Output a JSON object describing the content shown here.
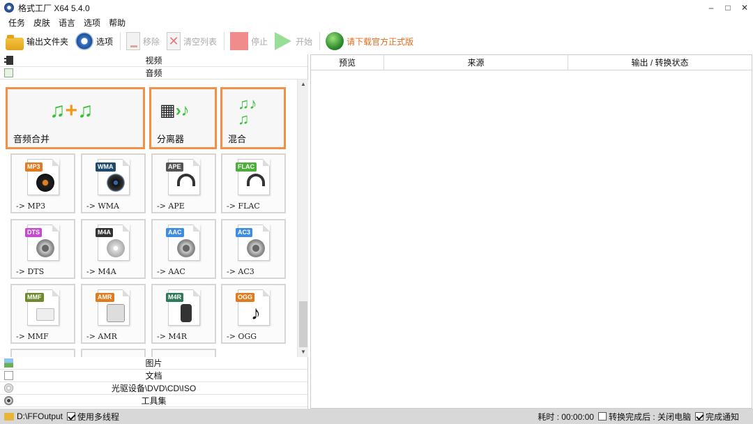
{
  "window": {
    "title": "格式工厂 X64 5.4.0",
    "min": "–",
    "max": "□",
    "close": "✕"
  },
  "menu": [
    "任务",
    "皮肤",
    "语言",
    "选项",
    "帮助"
  ],
  "toolbar": {
    "output_folder": "输出文件夹",
    "options": "选项",
    "remove": "移除",
    "clear_list": "清空列表",
    "stop": "停止",
    "start": "开始",
    "download": "请下载官方正式版"
  },
  "categories": {
    "video": "视频",
    "audio": "音频",
    "picture": "图片",
    "document": "文档",
    "disc": "光驱设备\\DVD\\CD\\ISO",
    "tools": "工具集"
  },
  "audio_tools": {
    "merge": "音频合并",
    "splitter": "分离器",
    "mix": "混合"
  },
  "formats": [
    {
      "badge": "MP3",
      "label": "-> MP3",
      "color": "#e07c1f"
    },
    {
      "badge": "WMA",
      "label": "-> WMA",
      "color": "#1e4a6e"
    },
    {
      "badge": "APE",
      "label": "-> APE",
      "color": "#555555"
    },
    {
      "badge": "FLAC",
      "label": "-> FLAC",
      "color": "#4caf3a"
    },
    {
      "badge": "DTS",
      "label": "-> DTS",
      "color": "#c44ad0"
    },
    {
      "badge": "M4A",
      "label": "-> M4A",
      "color": "#333333"
    },
    {
      "badge": "AAC",
      "label": "-> AAC",
      "color": "#3e8de0"
    },
    {
      "badge": "AC3",
      "label": "-> AC3",
      "color": "#3e8de0"
    },
    {
      "badge": "MMF",
      "label": "-> MMF",
      "color": "#6f8a2e"
    },
    {
      "badge": "AMR",
      "label": "-> AMR",
      "color": "#e07c1f"
    },
    {
      "badge": "M4R",
      "label": "-> M4R",
      "color": "#2f7a5a"
    },
    {
      "badge": "OGG",
      "label": "-> OGG",
      "color": "#e07c1f"
    }
  ],
  "table": {
    "headers": [
      "预览",
      "来源",
      "输出 / 转换状态"
    ]
  },
  "statusbar": {
    "output_path": "D:\\FFOutput",
    "multithread": "使用多线程",
    "elapsed": "耗时 : 00:00:00",
    "after_convert": "转换完成后 : 关闭电脑",
    "notify": "完成通知"
  }
}
